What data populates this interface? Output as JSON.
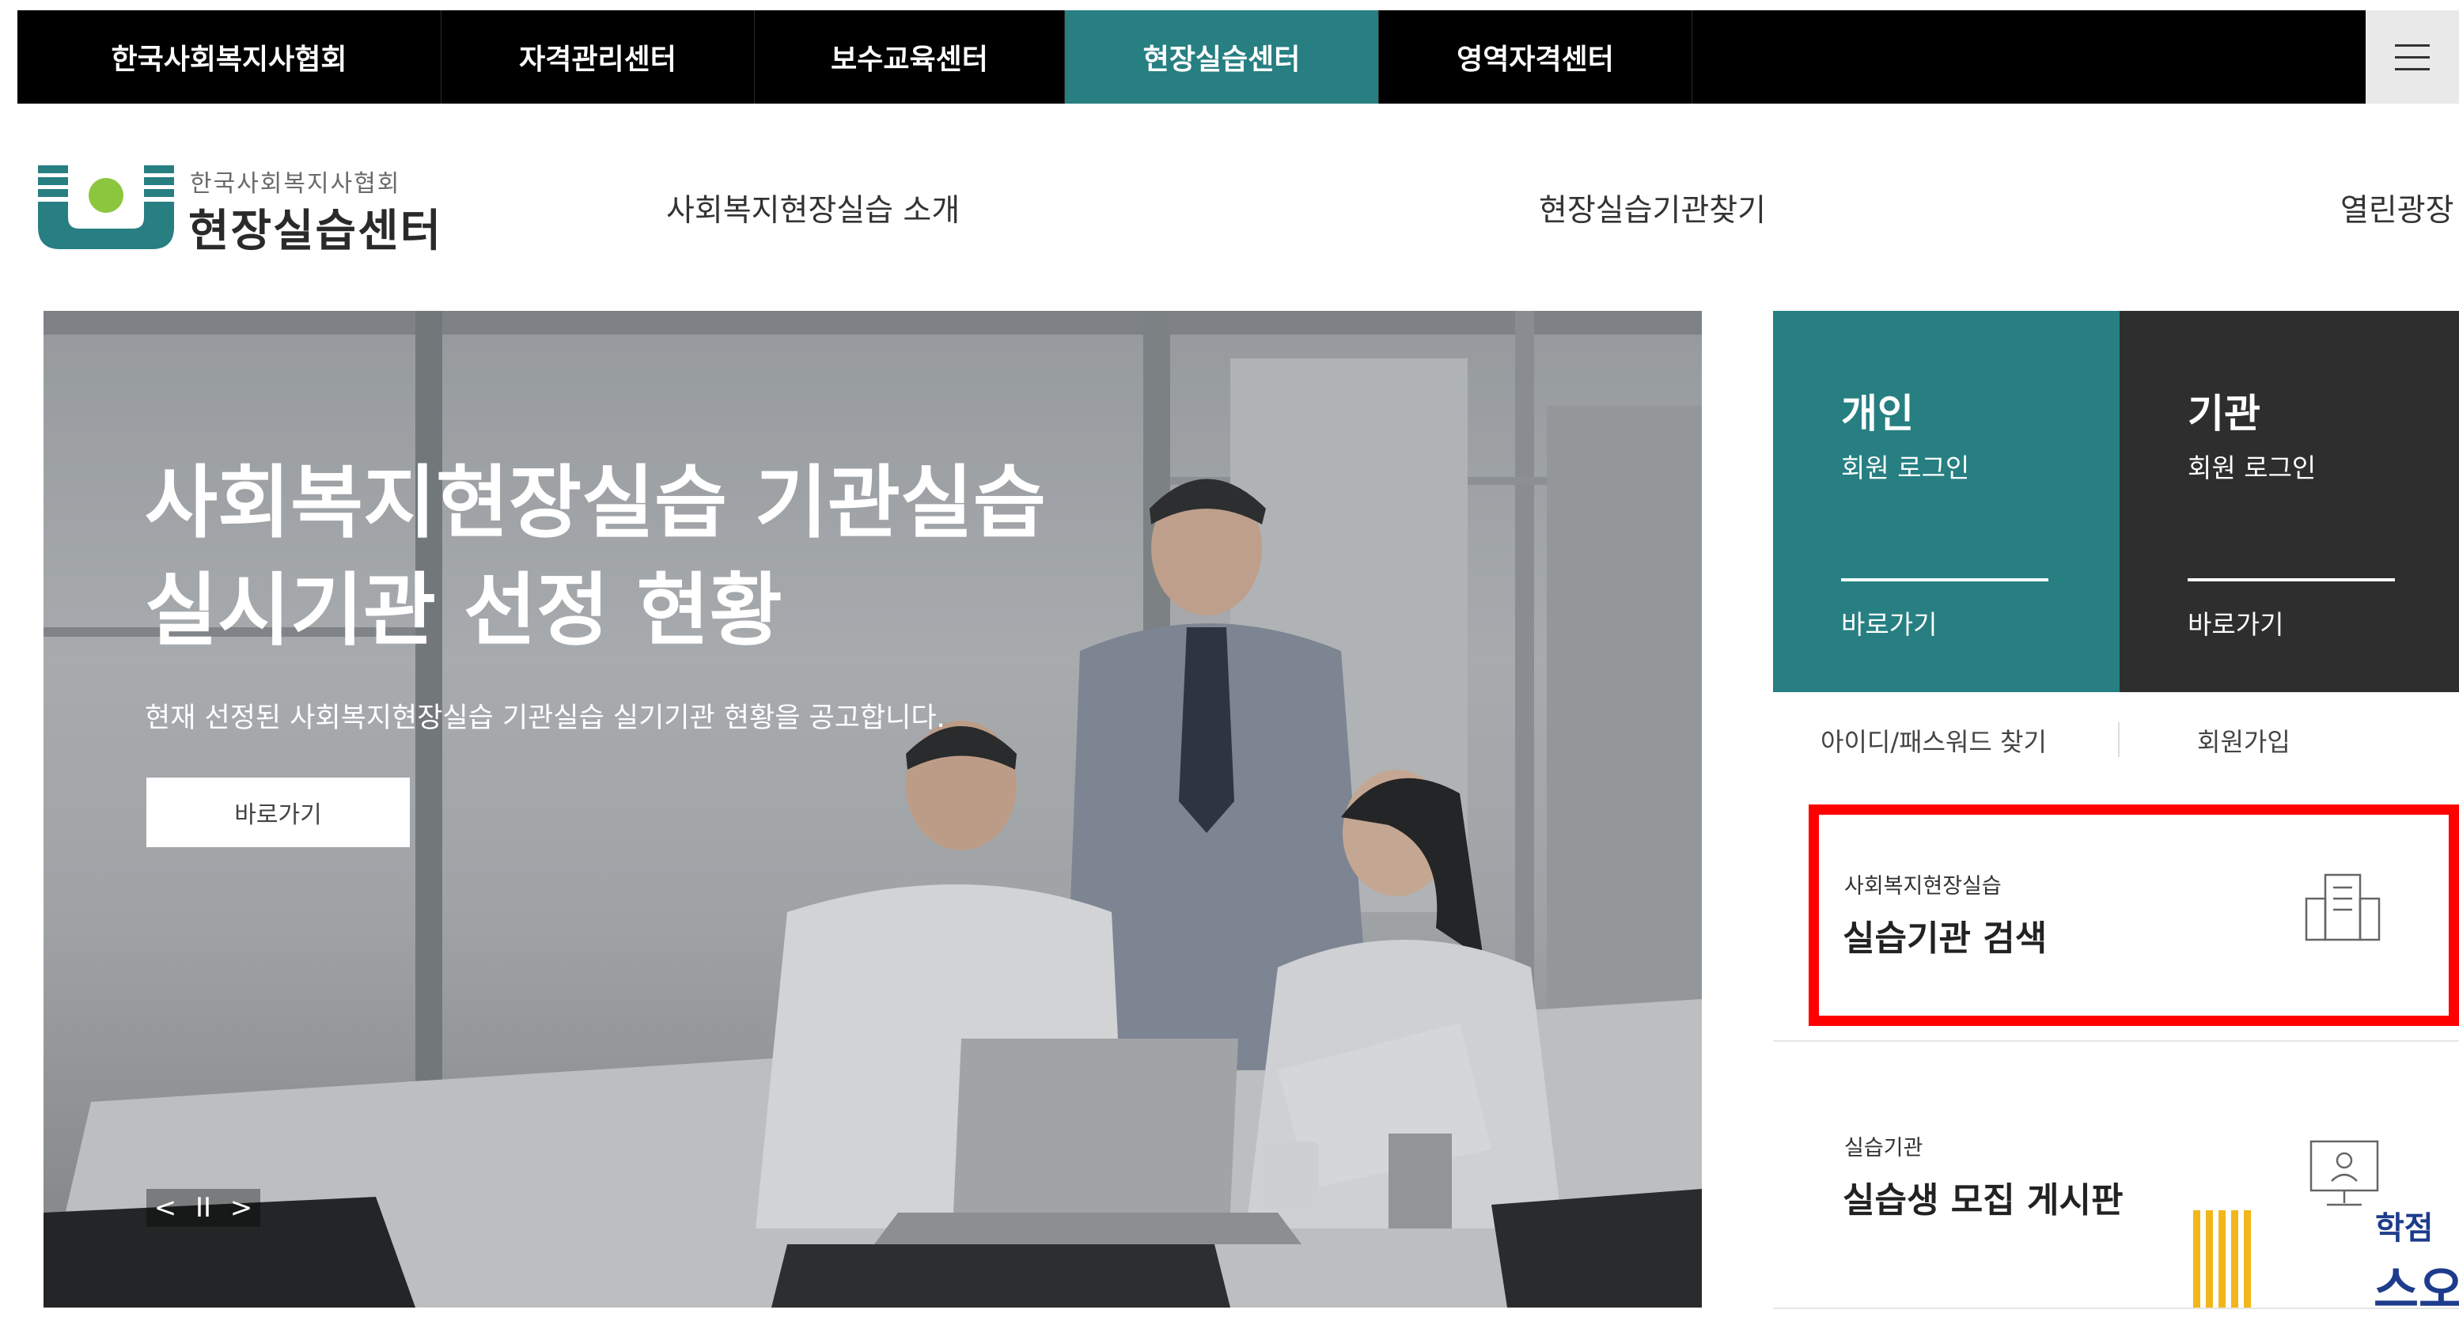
{
  "top_nav": {
    "tabs": [
      {
        "label": "한국사회복지사협회",
        "active": false
      },
      {
        "label": "자격관리센터",
        "active": false
      },
      {
        "label": "보수교육센터",
        "active": false
      },
      {
        "label": "현장실습센터",
        "active": true
      },
      {
        "label": "영역자격센터",
        "active": false
      }
    ],
    "menu_icon": "hamburger-icon"
  },
  "header": {
    "logo_sub": "한국사회복지사협회",
    "logo_main": "현장실습센터",
    "gnb": [
      "사회복지현장실습 소개",
      "현장실습기관찾기",
      "열린광장"
    ]
  },
  "hero": {
    "title_line1": "사회복지현장실습 기관실습",
    "title_line2": "실시기관 선정 현황",
    "description": "현재 선정된 사회복지현장실습 기관실습 실기기관 현황을 공고합니다.",
    "button": "바로가기",
    "controls": {
      "prev": "<",
      "pause": "II",
      "next": ">"
    }
  },
  "login": {
    "individual": {
      "title": "개인",
      "sub": "회원 로그인",
      "go": "바로가기"
    },
    "institution": {
      "title": "기관",
      "sub": "회원 로그인",
      "go": "바로가기"
    },
    "find": "아이디/패스워드 찾기",
    "join": "회원가입"
  },
  "cards": [
    {
      "sub": "사회복지현장실습",
      "title": "실습기관 검색",
      "icon": "building-icon"
    },
    {
      "sub": "실습기관",
      "title": "실습생 모집 게시판",
      "icon": "monitor-user-icon"
    }
  ],
  "corner_logo": {
    "line1": "학점",
    "line2": "스오"
  },
  "colors": {
    "accent": "#277f82",
    "dark": "#2e2e2e",
    "highlight": "#ff0000",
    "topbar": "#000000"
  }
}
